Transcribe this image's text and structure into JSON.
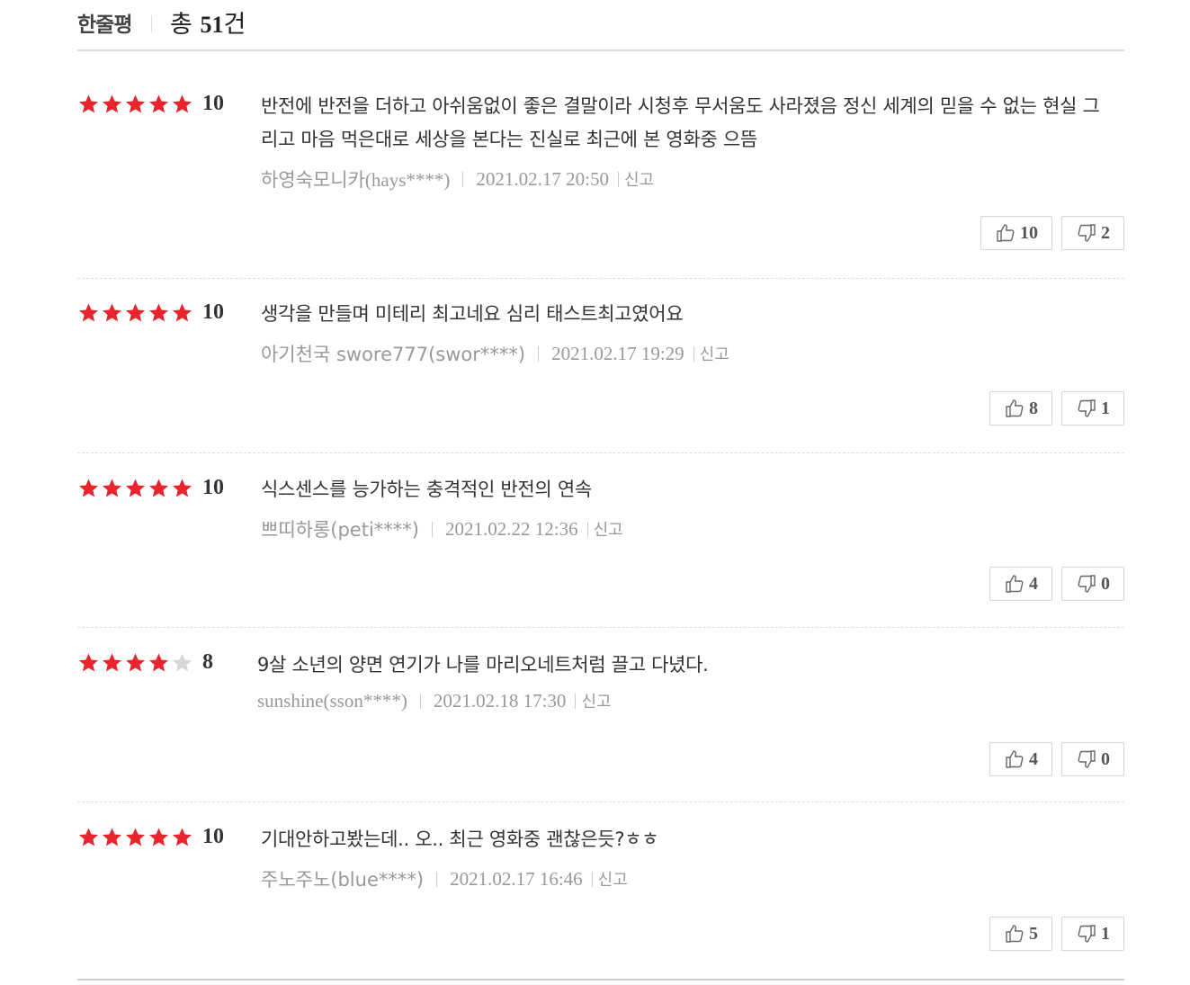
{
  "header": {
    "title": "한줄평",
    "total_prefix": "총 ",
    "total_count": "51",
    "total_suffix": "건"
  },
  "colors": {
    "star_on": "#e8242c",
    "star_off": "#d6d6d6"
  },
  "reviews": [
    {
      "rating_stars": 5,
      "score": "10",
      "text": "반전에 반전을 더하고 아쉬움없이 좋은 결말이라 시청후 무서움도 사라졌음 정신 세계의 믿을 수 없는 현실 그리고 마음 먹은대로 세상을 본다는 진실로 최근에 본 영화중 으뜸",
      "author": "하영숙모니카(hays****)",
      "date": "2021.02.17 20:50",
      "report": "신고",
      "likes": "10",
      "dislikes": "2"
    },
    {
      "rating_stars": 5,
      "score": "10",
      "text": "생각을 만들며 미테리 최고네요 심리 태스트최고였어요",
      "author": "아기천국 swore777(swor****)",
      "date": "2021.02.17 19:29",
      "report": "신고",
      "likes": "8",
      "dislikes": "1"
    },
    {
      "rating_stars": 5,
      "score": "10",
      "text": "식스센스를 능가하는 충격적인 반전의 연속",
      "author": "쁘띠하롱(peti****)",
      "date": "2021.02.22 12:36",
      "report": "신고",
      "likes": "4",
      "dislikes": "0"
    },
    {
      "rating_stars": 4,
      "score": "8",
      "text": "9살 소년의 양면 연기가 나를 마리오네트처럼 끌고 다녔다.",
      "author": "sunshine(sson****)",
      "date": "2021.02.18 17:30",
      "report": "신고",
      "likes": "4",
      "dislikes": "0"
    },
    {
      "rating_stars": 5,
      "score": "10",
      "text": "기대안하고봤는데.. 오.. 최근 영화중 괜찮은듯?ㅎㅎ",
      "author": "주노주노(blue****)",
      "date": "2021.02.17 16:46",
      "report": "신고",
      "likes": "5",
      "dislikes": "1"
    }
  ]
}
